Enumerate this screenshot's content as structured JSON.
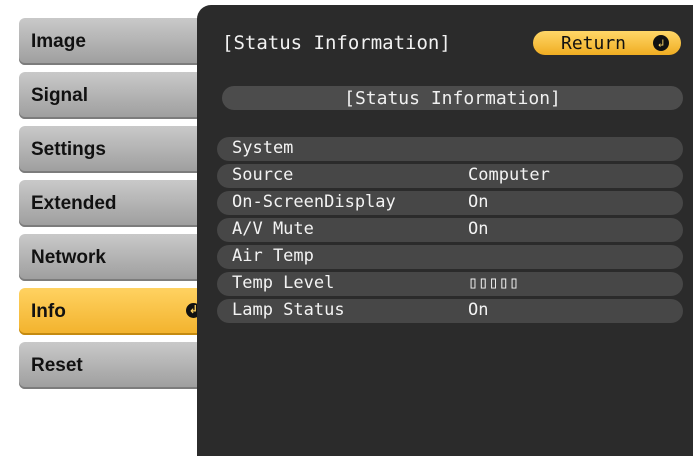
{
  "menu": {
    "items": [
      {
        "label": "Image"
      },
      {
        "label": "Signal"
      },
      {
        "label": "Settings"
      },
      {
        "label": "Extended"
      },
      {
        "label": "Network"
      },
      {
        "label": "Info"
      },
      {
        "label": "Reset"
      }
    ],
    "active_index": 5
  },
  "panel": {
    "title": "[Status Information]",
    "return_label": "Return",
    "section_title": "[Status Information]",
    "rows": [
      {
        "label": "System",
        "value": ""
      },
      {
        "label": "Source",
        "value": "Computer"
      },
      {
        "label": "On-ScreenDisplay",
        "value": "On"
      },
      {
        "label": "A/V Mute",
        "value": "On"
      },
      {
        "label": "Air Temp",
        "value": ""
      },
      {
        "label": "Temp Level",
        "value": "▯▯▯▯▯"
      },
      {
        "label": "Lamp Status",
        "value": "On"
      }
    ]
  },
  "colors": {
    "active": "#f2b22c",
    "panel_bg": "#2b2b2b",
    "row_bg": "#474747"
  }
}
